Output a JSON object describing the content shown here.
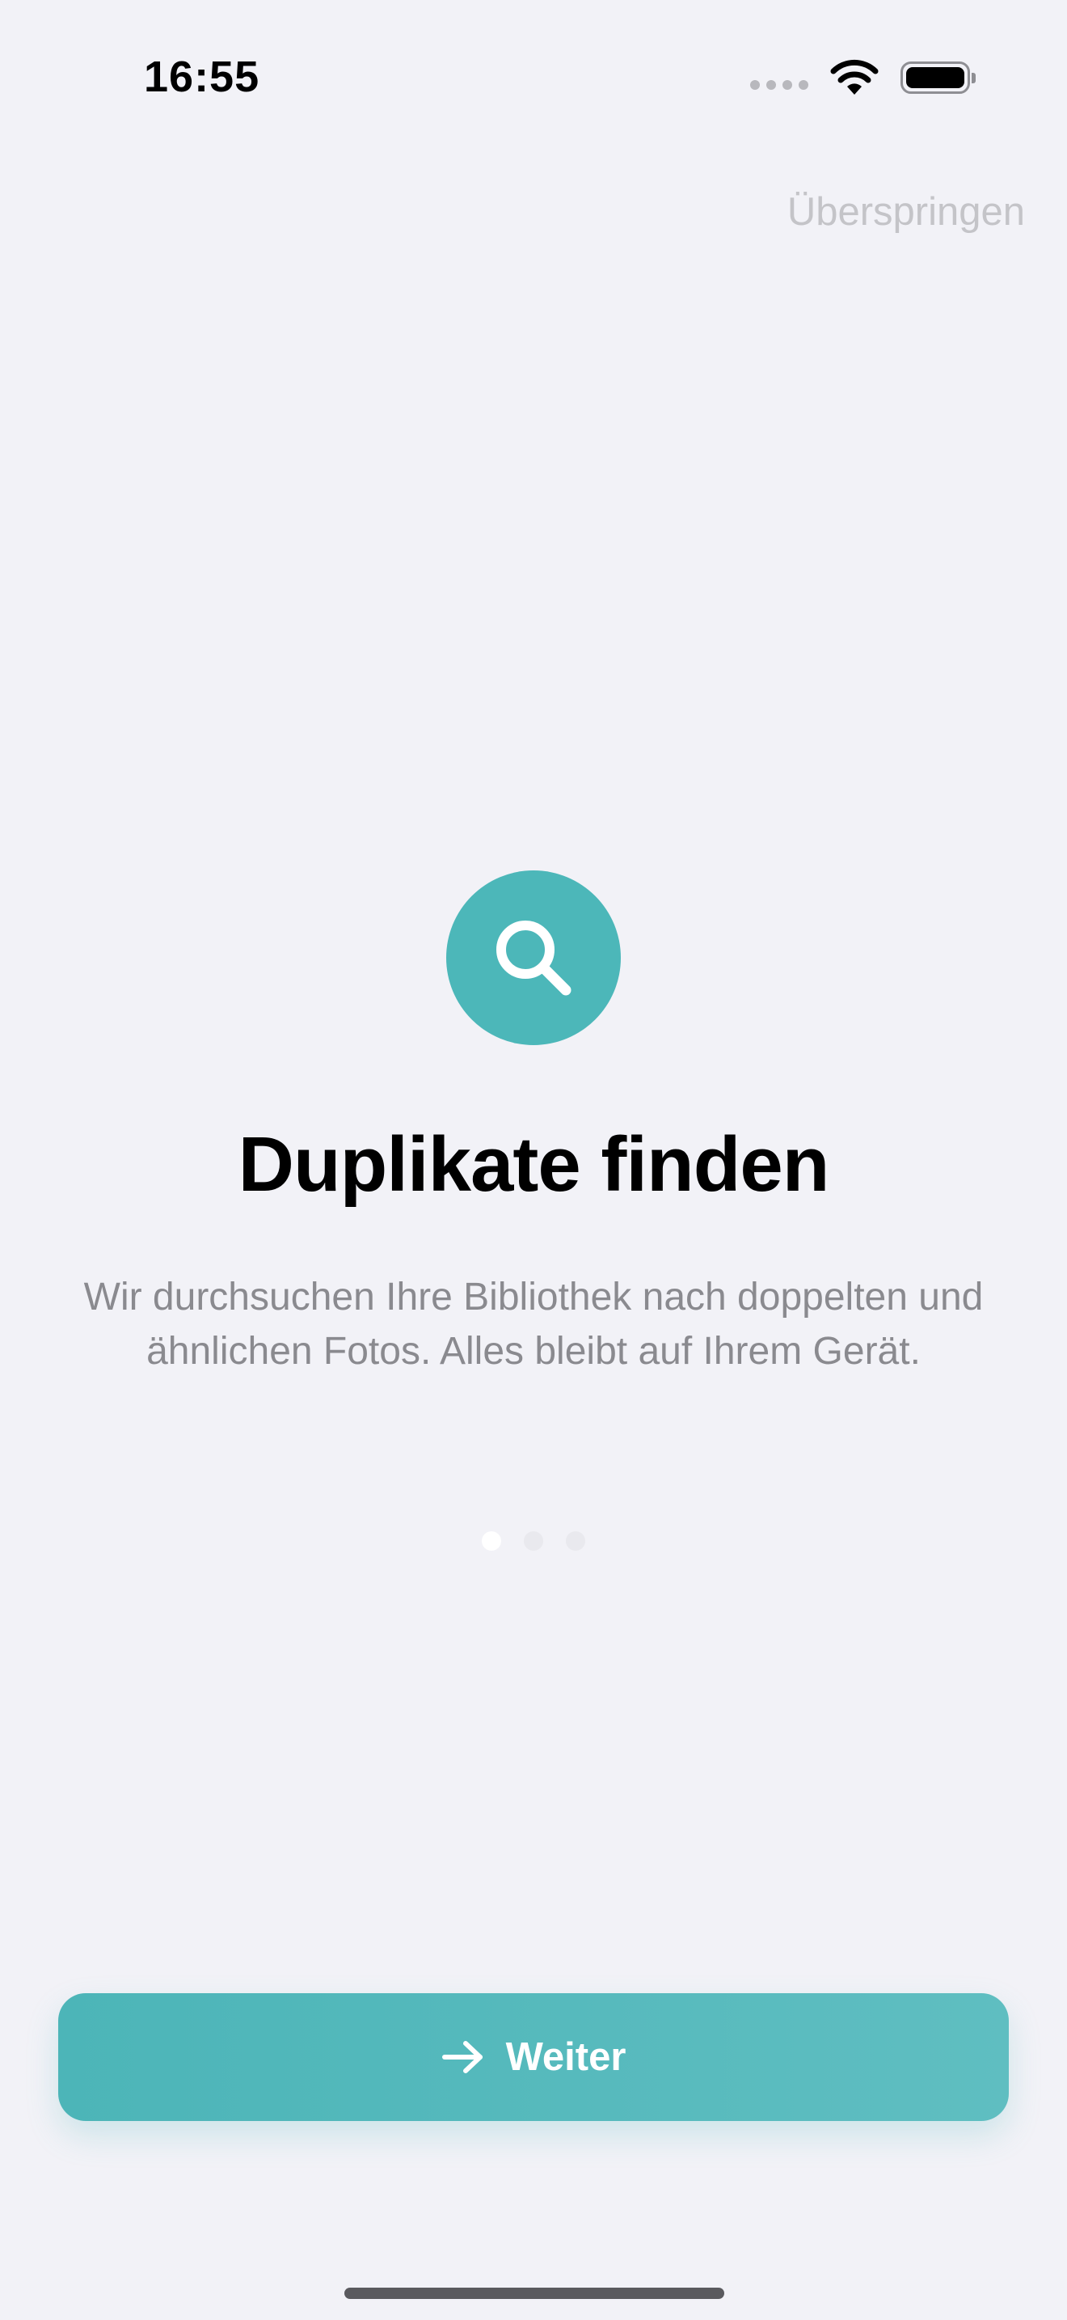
{
  "status_bar": {
    "time": "16:55",
    "icons": [
      "cellular-signal-icon",
      "wifi-icon",
      "battery-icon"
    ]
  },
  "skip_label": "Überspringen",
  "onboarding": {
    "icon": "magnifier-icon",
    "title": "Duplikate finden",
    "description": "Wir durchsuchen Ihre Bibliothek nach doppelten und ähnlichen Fotos. Alles bleibt auf Ihrem Gerät.",
    "page_count": 3,
    "current_page": 1
  },
  "continue_button": {
    "label": "Weiter",
    "icon": "arrow-right-icon"
  },
  "colors": {
    "accent": "#4cb7b9",
    "background": "#f2f2f7",
    "secondary_text": "#8a8a8f",
    "skip_text": "#c4c4c8"
  }
}
